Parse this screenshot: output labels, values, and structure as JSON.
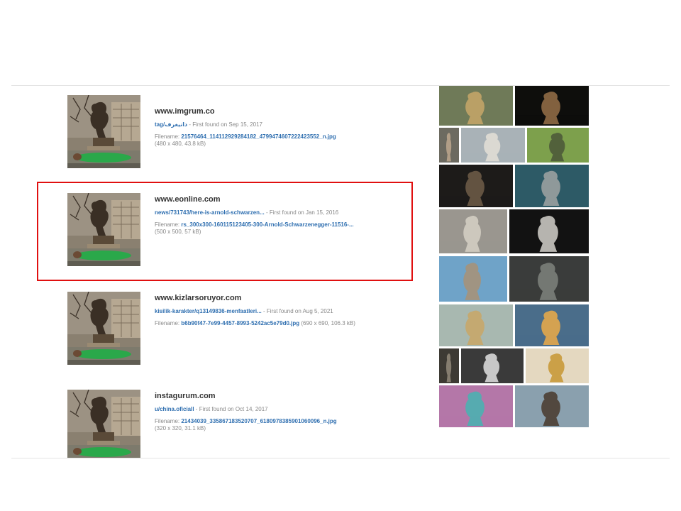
{
  "results": [
    {
      "domain": "www.imgrum.co",
      "link": "tag/دانيغرف",
      "first_found": "First found on Sep 15, 2017",
      "filename_label": "Filename:",
      "filename": "21576464_114112929284182_4799474607222423552_n.jpg",
      "dims": "(480 x 480, 43.8 kB)"
    },
    {
      "domain": "www.eonline.com",
      "link": "news/731743/here-is-arnold-schwarzen...",
      "first_found": "First found on Jan 15, 2016",
      "filename_label": "Filename:",
      "filename": "rs_300x300-160115123405-300-Arnold-Schwarzenegger-11516-...",
      "dims": "(500 x 500, 57 kB)"
    },
    {
      "domain": "www.kizlarsoruyor.com",
      "link": "kisilik-karakter/q13149836-menfaatleri...",
      "first_found": "First found on Aug 5, 2021",
      "filename_label": "Filename:",
      "filename": "b6b90f47-7e99-4457-8993-5242ac5e79d0.jpg",
      "dims": "(690 x 690, 106.3 kB)"
    },
    {
      "domain": "instagurum.com",
      "link": "u/china.oficiall",
      "first_found": "First found on Oct 14, 2017",
      "filename_label": "Filename:",
      "filename": "21434039_335867183520707_6180978385901060096_n.jpg",
      "dims": "(320 x 320, 31.1 kB)"
    }
  ],
  "thumbnail_icon": "statue-with-sleeping-man-photo",
  "sidebar": {
    "tiles": [
      {
        "name": "rodin-thinker-forest-tile",
        "bg": "#6f7a58",
        "fg": "#c2a468"
      },
      {
        "name": "dark-statue-night-tile",
        "bg": "#0e0e0c",
        "fg": "#8f6a45"
      },
      {
        "name": "statue-small-tile",
        "bg": "#6c6a60",
        "fg": "#b9a48c"
      },
      {
        "name": "statue-of-liberty-face-tile",
        "bg": "#a9b2b7",
        "fg": "#e0ddd5"
      },
      {
        "name": "park-statue-tile",
        "bg": "#7da04c",
        "fg": "#4e5a3a"
      },
      {
        "name": "bronze-bust-dark-tile",
        "bg": "#1d1b19",
        "fg": "#6b5a46"
      },
      {
        "name": "seated-statue-teal-tile",
        "bg": "#2d5a66",
        "fg": "#9aa0a0"
      },
      {
        "name": "draped-figure-tile",
        "bg": "#9a968f",
        "fg": "#d3cdc2"
      },
      {
        "name": "marble-face-closeup-tile",
        "bg": "#121212",
        "fg": "#c9c7c1"
      },
      {
        "name": "buddha-blue-sky-tile",
        "bg": "#6fa3c8",
        "fg": "#a5927a"
      },
      {
        "name": "thinker-dark-tile",
        "bg": "#3a3c3b",
        "fg": "#7b7e7a"
      },
      {
        "name": "fountain-statue-arches-tile",
        "bg": "#a8b8b0",
        "fg": "#c6a76a"
      },
      {
        "name": "golden-statue-sunset-tile",
        "bg": "#4a6d8a",
        "fg": "#e3a74a"
      },
      {
        "name": "small-statue-dark-tile",
        "bg": "#3d3a34",
        "fg": "#8d8576"
      },
      {
        "name": "black-white-relief-tile",
        "bg": "#3a3a3a",
        "fg": "#d8d8d8"
      },
      {
        "name": "golden-horse-hall-tile",
        "bg": "#e4d8c0",
        "fg": "#c89a3a"
      },
      {
        "name": "liberty-pink-sky-tile",
        "bg": "#b477a8",
        "fg": "#4bb0b0"
      },
      {
        "name": "warrior-statue-mountains-tile",
        "bg": "#8aa0ae",
        "fg": "#4b3e33"
      }
    ]
  },
  "colors": {
    "link": "#2f6fb0",
    "highlight": "#e01010",
    "divider": "#e3e3e3"
  }
}
